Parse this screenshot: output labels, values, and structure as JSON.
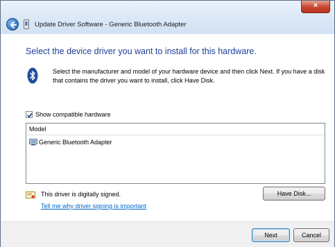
{
  "window": {
    "title": "Update Driver Software - Generic Bluetooth Adapter",
    "close_label": "×"
  },
  "main": {
    "heading": "Select the device driver you want to install for this hardware.",
    "instructions": "Select the manufacturer and model of your hardware device and then click Next. If you have a disk that contains the driver you want to install, click Have Disk.",
    "show_compatible_label": "Show compatible hardware",
    "show_compatible_checked": true,
    "model_list": {
      "header": "Model",
      "items": [
        "Generic Bluetooth Adapter"
      ]
    },
    "signed_text": "This driver is digitally signed.",
    "signing_link": "Tell me why driver signing is important",
    "have_disk_label": "Have Disk..."
  },
  "footer": {
    "next_label": "Next",
    "cancel_label": "Cancel"
  },
  "icons": {
    "back": "back-arrow-icon",
    "title": "device-icon",
    "bluetooth": "bluetooth-icon",
    "list_item": "device-icon",
    "signed": "certificate-icon"
  },
  "colors": {
    "heading": "#1e3e99",
    "link": "#0066cc",
    "close_button": "#c8452e"
  }
}
